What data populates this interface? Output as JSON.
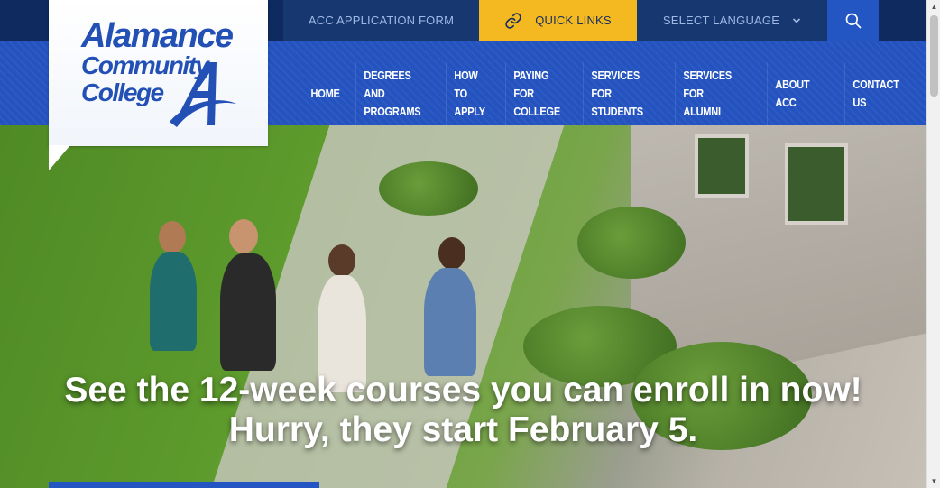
{
  "utility_bar": {
    "application_form": "ACC APPLICATION FORM",
    "quick_links": "QUICK LINKS",
    "quick_links_icon": "link-icon",
    "select_language": "SELECT LANGUAGE",
    "language_icon": "chevron-down-icon",
    "search_icon": "search-icon"
  },
  "logo": {
    "line1": "Alamance",
    "line2": "Community",
    "line3": "College"
  },
  "nav": {
    "items": [
      {
        "label": "HOME"
      },
      {
        "label": "DEGREES AND\nPROGRAMS"
      },
      {
        "label": "HOW TO\nAPPLY"
      },
      {
        "label": "PAYING FOR\nCOLLEGE"
      },
      {
        "label": "SERVICES FOR\nSTUDENTS"
      },
      {
        "label": "SERVICES FOR\nALUMNI"
      },
      {
        "label": "ABOUT ACC"
      },
      {
        "label": "CONTACT US"
      }
    ]
  },
  "hero": {
    "headline": "See the 12-week courses you can enroll in now!\nHurry, they start February 5."
  },
  "colors": {
    "topbar": "#0e2a5e",
    "navbar": "#2453c0",
    "accent_yellow": "#f4b920",
    "brand_blue": "#2350b5"
  }
}
